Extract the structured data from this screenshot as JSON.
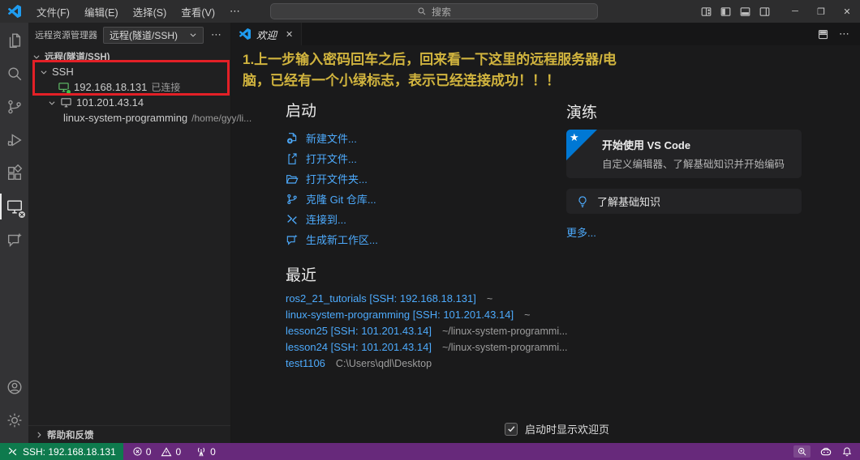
{
  "titlebar": {
    "menus": [
      "文件(F)",
      "编辑(E)",
      "选择(S)",
      "查看(V)"
    ],
    "more": "⋯",
    "search_placeholder": "搜索"
  },
  "tab": {
    "label": "欢迎"
  },
  "sidebar": {
    "header": {
      "title": "远程资源管理器",
      "dropdown_value": "远程(隧道/SSH)",
      "more": "⋯"
    },
    "tree": {
      "section_label": "远程(隧道/SSH)",
      "ssh_label": "SSH",
      "host1": {
        "name": "192.168.18.131",
        "status": "已连接"
      },
      "host2": {
        "name": "101.201.43.14"
      },
      "folder": {
        "name": "linux-system-programming",
        "path": "/home/gyy/li..."
      }
    },
    "footer_label": "帮助和反馈"
  },
  "welcome": {
    "annotation": {
      "line1": "1.上一步输入密码回车之后，回来看一下这里的远程服务器/电",
      "line2": "脑，已经有一个小绿标志，表示已经连接成功！！！"
    },
    "start": {
      "heading": "启动",
      "items": [
        {
          "label": "新建文件...",
          "icon": "new-file-icon"
        },
        {
          "label": "打开文件...",
          "icon": "open-file-icon"
        },
        {
          "label": "打开文件夹...",
          "icon": "open-folder-icon"
        },
        {
          "label": "克隆 Git 仓库...",
          "icon": "git-clone-icon"
        },
        {
          "label": "连接到...",
          "icon": "remote-icon"
        },
        {
          "label": "生成新工作区...",
          "icon": "new-workspace-icon"
        }
      ]
    },
    "recent": {
      "heading": "最近",
      "items": [
        {
          "name": "ros2_21_tutorials [SSH: 192.168.18.131]",
          "path": "~"
        },
        {
          "name": "linux-system-programming [SSH: 101.201.43.14]",
          "path": "~"
        },
        {
          "name": "lesson25 [SSH: 101.201.43.14]",
          "path": "~/linux-system-programmi..."
        },
        {
          "name": "lesson24 [SSH: 101.201.43.14]",
          "path": "~/linux-system-programmi..."
        },
        {
          "name": "test1106",
          "path": "C:\\Users\\qdl\\Desktop"
        }
      ]
    },
    "walkthroughs": {
      "heading": "演练",
      "card1": {
        "title": "开始使用 VS Code",
        "desc": "自定义编辑器、了解基础知识并开始编码"
      },
      "card2": {
        "title": "了解基础知识"
      },
      "more_label": "更多..."
    },
    "checkbox_label": "启动时显示欢迎页"
  },
  "statusbar": {
    "remote_label": "SSH: 192.168.18.131",
    "errors": "0",
    "warnings": "0",
    "ports": "0"
  },
  "colors": {
    "accent_blue": "#4daafc",
    "annotation_yellow": "#d1b43e",
    "highlight_red": "#e32027",
    "remote_green": "#0e7a4d",
    "statusbar_purple": "#67297b",
    "connected_green": "#3fc04a"
  }
}
